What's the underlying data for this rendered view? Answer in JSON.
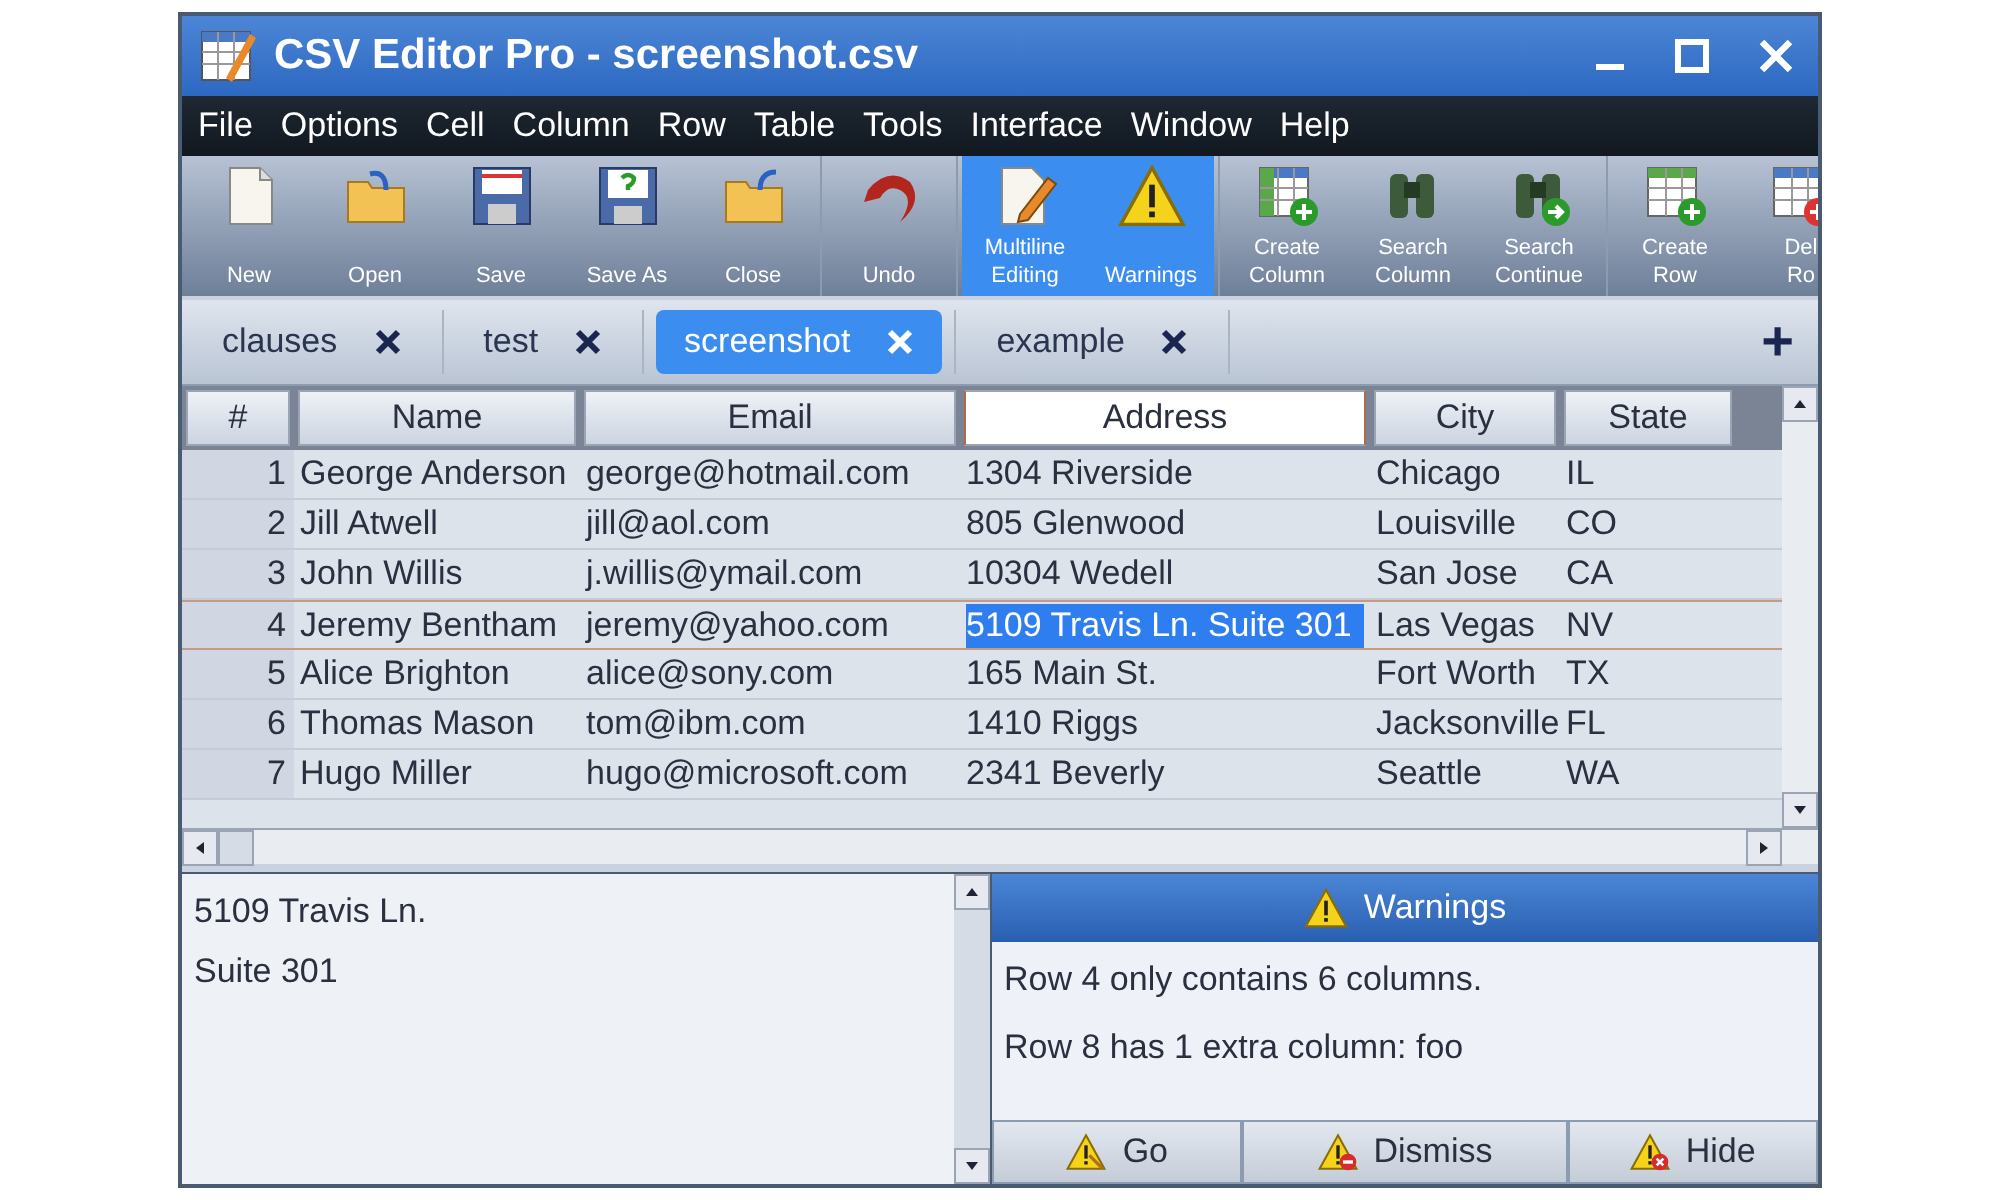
{
  "window": {
    "title": "CSV Editor Pro - screenshot.csv"
  },
  "menu": [
    "File",
    "Options",
    "Cell",
    "Column",
    "Row",
    "Table",
    "Tools",
    "Interface",
    "Window",
    "Help"
  ],
  "toolbar": [
    [
      {
        "kind": "new",
        "lines": [
          "New"
        ],
        "selected": false
      },
      {
        "kind": "open",
        "lines": [
          "Open"
        ],
        "selected": false
      },
      {
        "kind": "save",
        "lines": [
          "Save"
        ],
        "selected": false
      },
      {
        "kind": "saveas",
        "lines": [
          "Save As"
        ],
        "selected": false
      },
      {
        "kind": "close",
        "lines": [
          "Close"
        ],
        "selected": false
      }
    ],
    [
      {
        "kind": "undo",
        "lines": [
          "Undo"
        ],
        "selected": false
      }
    ],
    [
      {
        "kind": "multiline",
        "lines": [
          "Multiline",
          "Editing"
        ],
        "selected": true
      },
      {
        "kind": "warning",
        "lines": [
          "Warnings"
        ],
        "selected": true
      }
    ],
    [
      {
        "kind": "addcolumn",
        "lines": [
          "Create",
          "Column"
        ],
        "selected": false
      },
      {
        "kind": "search",
        "lines": [
          "Search",
          "Column"
        ],
        "selected": false
      },
      {
        "kind": "searchnext",
        "lines": [
          "Search",
          "Continue"
        ],
        "selected": false
      }
    ],
    [
      {
        "kind": "addrow",
        "lines": [
          "Create",
          "Row"
        ],
        "selected": false
      },
      {
        "kind": "delrow",
        "lines": [
          "Del",
          "Ro"
        ],
        "selected": false
      }
    ]
  ],
  "tabs": [
    {
      "label": "clauses",
      "selected": false
    },
    {
      "label": "test",
      "selected": false
    },
    {
      "label": "screenshot",
      "selected": true
    },
    {
      "label": "example",
      "selected": false
    }
  ],
  "new_tab": "+",
  "table": {
    "columns": [
      "#",
      "Name",
      "Email",
      "Address",
      "City",
      "State"
    ],
    "rows": [
      {
        "cells": [
          {
            "text": "1",
            "selected": false
          },
          {
            "text": "George Anderson",
            "selected": false
          },
          {
            "text": "george@hotmail.com",
            "selected": false
          },
          {
            "text": "1304 Riverside",
            "selected": false
          },
          {
            "text": "Chicago",
            "selected": false
          },
          {
            "text": "IL",
            "selected": false
          }
        ]
      },
      {
        "cells": [
          {
            "text": "2",
            "selected": false
          },
          {
            "text": "Jill Atwell",
            "selected": false
          },
          {
            "text": "jill@aol.com",
            "selected": false
          },
          {
            "text": "805 Glenwood",
            "selected": false
          },
          {
            "text": "Louisville",
            "selected": false
          },
          {
            "text": "CO",
            "selected": false
          }
        ]
      },
      {
        "cells": [
          {
            "text": "3",
            "selected": false
          },
          {
            "text": "John Willis",
            "selected": false
          },
          {
            "text": "j.willis@ymail.com",
            "selected": false
          },
          {
            "text": "10304 Wedell",
            "selected": false
          },
          {
            "text": "San Jose",
            "selected": false
          },
          {
            "text": "CA",
            "selected": false
          }
        ]
      },
      {
        "cells": [
          {
            "text": "4",
            "selected": false
          },
          {
            "text": "Jeremy Bentham",
            "selected": false
          },
          {
            "text": "jeremy@yahoo.com",
            "selected": false
          },
          {
            "text": "5109 Travis Ln. Suite 301",
            "selected": true
          },
          {
            "text": "Las Vegas",
            "selected": false
          },
          {
            "text": "NV",
            "selected": false
          }
        ]
      },
      {
        "cells": [
          {
            "text": "5",
            "selected": false
          },
          {
            "text": "Alice Brighton",
            "selected": false
          },
          {
            "text": "alice@sony.com",
            "selected": false
          },
          {
            "text": "165 Main St.",
            "selected": false
          },
          {
            "text": "Fort Worth",
            "selected": false
          },
          {
            "text": "TX",
            "selected": false
          }
        ]
      },
      {
        "cells": [
          {
            "text": "6",
            "selected": false
          },
          {
            "text": "Thomas Mason",
            "selected": false
          },
          {
            "text": "tom@ibm.com",
            "selected": false
          },
          {
            "text": "1410 Riggs",
            "selected": false
          },
          {
            "text": "Jacksonville",
            "selected": false
          },
          {
            "text": "FL",
            "selected": false
          }
        ]
      },
      {
        "cells": [
          {
            "text": "7",
            "selected": false
          },
          {
            "text": "Hugo Miller",
            "selected": false
          },
          {
            "text": "hugo@microsoft.com",
            "selected": false
          },
          {
            "text": "2341 Beverly",
            "selected": false
          },
          {
            "text": "Seattle",
            "selected": false
          },
          {
            "text": "WA",
            "selected": false
          }
        ]
      }
    ]
  },
  "editor": {
    "lines": [
      "5109 Travis Ln.",
      "Suite 301"
    ]
  },
  "warnings": {
    "title": "Warnings",
    "messages": [
      "Row 4 only contains 6 columns.",
      "Row 8 has 1 extra column: foo"
    ],
    "buttons": [
      {
        "kind": "go",
        "label": "Go"
      },
      {
        "kind": "dismiss",
        "label": "Dismiss"
      },
      {
        "kind": "hide",
        "label": "Hide"
      }
    ]
  }
}
